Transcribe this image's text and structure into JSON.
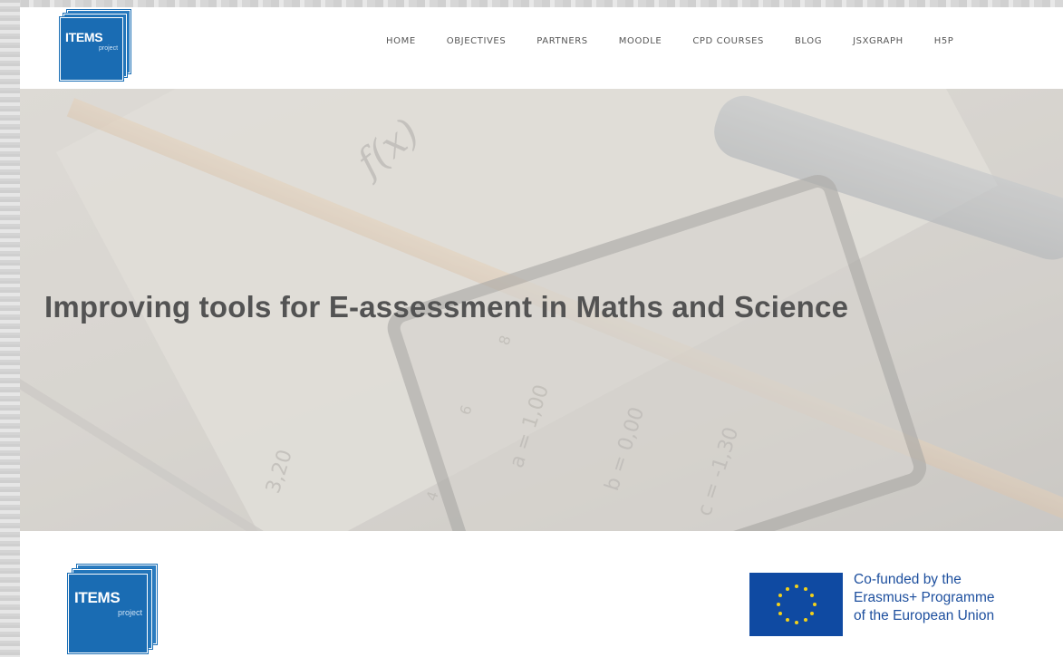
{
  "header": {
    "logo": {
      "title": "ITEMS",
      "subtitle": "project"
    },
    "nav": [
      {
        "label": "HOME"
      },
      {
        "label": "OBJECTIVES"
      },
      {
        "label": "PARTNERS"
      },
      {
        "label": "MOODLE"
      },
      {
        "label": "CPD COURSES"
      },
      {
        "label": "BLOG"
      },
      {
        "label": "JSXGRAPH"
      },
      {
        "label": "H5P"
      }
    ]
  },
  "hero": {
    "title": "Improving tools for E-assessment in Maths and Science",
    "background_texts": {
      "fx": "f(x)",
      "nums": [
        "3,20",
        "4",
        "6",
        "8",
        "a = 1,00",
        "b = 0,00",
        "c = -1,30"
      ]
    }
  },
  "footer": {
    "logo": {
      "title": "ITEMS",
      "subtitle": "project"
    },
    "eu_lines": [
      "Co-funded by the",
      "Erasmus+ Programme",
      "of the European Union"
    ]
  },
  "colors": {
    "brand_blue": "#1b6fb6",
    "eu_blue": "#0f4aa2",
    "eu_star": "#f2d11a",
    "eu_text": "#1d4f9e",
    "nav_text": "#555555",
    "hero_title": "#535353"
  }
}
